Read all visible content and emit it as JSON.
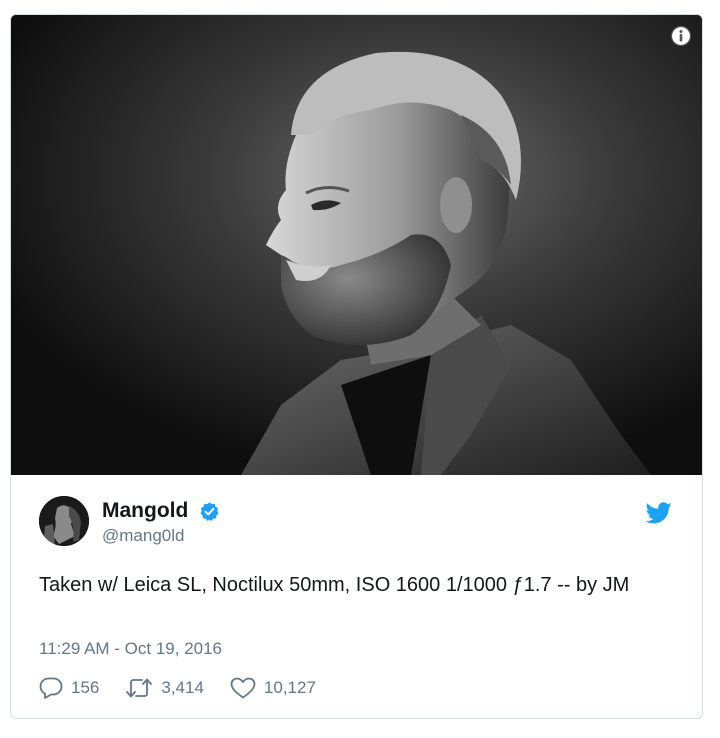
{
  "tweet": {
    "display_name": "Mangold",
    "handle": "@mang0ld",
    "text": "Taken w/ Leica SL, Noctilux 50mm, ISO 1600 1/1000 ƒ1.7 -- by JM",
    "timestamp": "11:29 AM - Oct 19, 2016",
    "verified": true
  },
  "actions": {
    "replies": "156",
    "retweets": "3,414",
    "likes": "10,127"
  },
  "colors": {
    "twitter_blue": "#1da1f2",
    "text_primary": "#14171a",
    "text_secondary": "#657786",
    "border": "#d9dee3"
  },
  "icons": {
    "info": "info-icon",
    "verified": "verified-badge-icon",
    "brand": "twitter-bird-icon",
    "reply": "reply-bubble-icon",
    "retweet": "retweet-arrows-icon",
    "like": "heart-icon"
  }
}
